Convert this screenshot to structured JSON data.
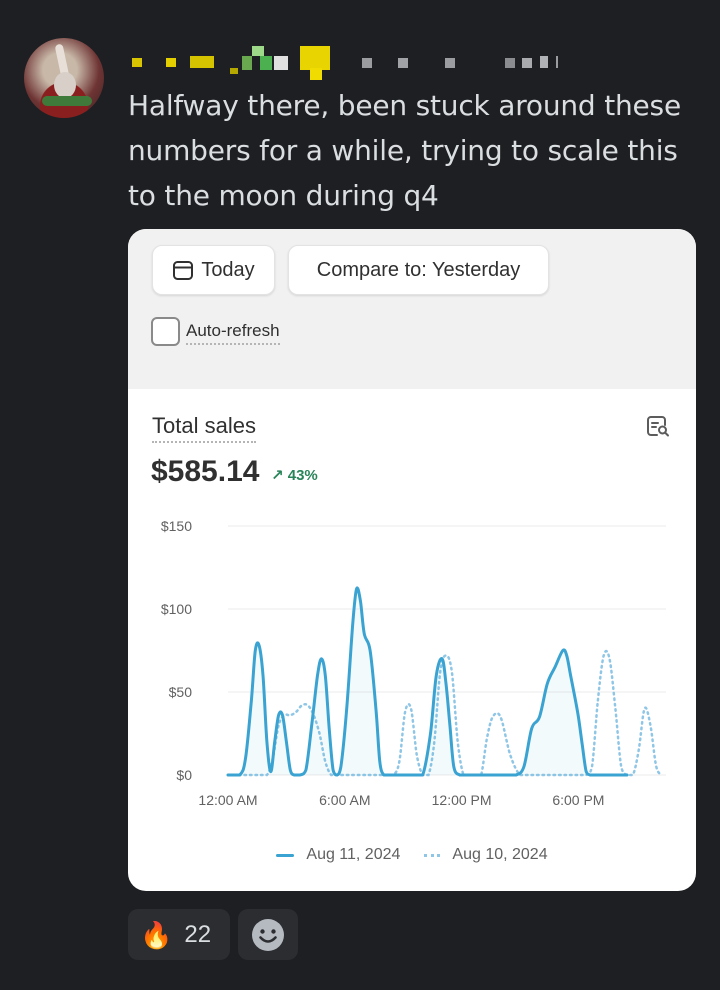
{
  "message": {
    "text": "Halfway there, been stuck around these numbers for a while, trying to scale this to the moon during q4"
  },
  "screenshot": {
    "date_button": "Today",
    "compare_button": "Compare to: Yesterday",
    "auto_refresh_label": "Auto-refresh",
    "auto_refresh_checked": false,
    "total_sales_label": "Total sales",
    "total_sales_value": "$585.14",
    "total_sales_change": "43%",
    "change_direction": "up",
    "colors": {
      "current": "#3aa3d2",
      "previous": "#8fc6e6",
      "positive": "#29845a"
    }
  },
  "chart_data": {
    "type": "line",
    "y_ticks": [
      "$150",
      "$100",
      "$50",
      "$0"
    ],
    "ylim": [
      0,
      150
    ],
    "x_ticks": [
      "12:00 AM",
      "6:00 AM",
      "12:00 PM",
      "6:00 PM"
    ],
    "series": [
      {
        "name": "Aug 11, 2024",
        "style": "solid",
        "x": [
          0,
          0.6,
          0.9,
          1.2,
          1.4,
          1.6,
          1.8,
          2.0,
          2.2,
          2.4,
          2.6,
          2.8,
          3.0,
          3.2,
          3.4,
          3.7,
          4.0,
          4.3,
          4.6,
          4.8,
          5.0,
          5.2,
          5.4,
          5.6,
          5.8,
          6.1,
          6.4,
          6.6,
          6.8,
          7.0,
          7.3,
          7.6,
          7.8,
          8.0,
          8.2,
          8.4,
          8.6,
          8.9,
          9.2,
          9.6,
          10.0,
          10.4,
          10.7,
          11.0,
          11.2,
          11.4,
          11.6,
          11.9,
          12.2,
          12.5,
          12.8,
          13.1,
          13.4,
          13.7,
          14.0,
          14.4,
          14.8,
          15.2,
          15.6,
          16.0,
          16.4,
          16.8,
          17.2,
          17.4,
          17.6,
          17.8,
          18.0,
          18.2,
          18.4,
          18.6,
          18.8,
          19.0,
          19.2,
          19.5,
          20.0,
          20.5
        ],
        "y": [
          0,
          0,
          10,
          45,
          75,
          78,
          60,
          20,
          2,
          20,
          36,
          36,
          20,
          3,
          0,
          0,
          3,
          30,
          60,
          70,
          60,
          28,
          3,
          0,
          5,
          40,
          90,
          112,
          105,
          85,
          75,
          40,
          8,
          0,
          0,
          0,
          0,
          0,
          0,
          0,
          0,
          25,
          60,
          70,
          55,
          30,
          5,
          0,
          0,
          0,
          0,
          0,
          0,
          0,
          0,
          0,
          0,
          5,
          28,
          35,
          55,
          65,
          75,
          72,
          60,
          48,
          35,
          18,
          2,
          0,
          0,
          0,
          0,
          0,
          0,
          0
        ]
      },
      {
        "name": "Aug 10, 2024",
        "style": "dotted",
        "x": [
          0,
          0.5,
          1.0,
          1.5,
          2.0,
          2.3,
          2.6,
          2.9,
          3.2,
          3.5,
          3.8,
          4.1,
          4.4,
          4.7,
          5.0,
          5.3,
          5.6,
          5.9,
          6.2,
          6.5,
          7.0,
          7.3,
          7.6,
          7.9,
          8.2,
          8.5,
          8.8,
          9.1,
          9.4,
          9.7,
          10.0,
          10.3,
          10.6,
          10.9,
          11.2,
          11.5,
          11.8,
          12.1,
          12.4,
          12.7,
          13.0,
          13.3,
          13.6,
          14.0,
          14.5,
          15.0,
          15.5,
          16.0,
          16.5,
          17.0,
          17.4,
          17.8,
          18.1,
          18.4,
          18.7,
          19.0,
          19.3,
          19.6,
          19.9,
          20.2,
          20.5,
          20.8,
          21.1,
          21.4,
          21.7,
          22.0,
          22.3
        ],
        "y": [
          0,
          0,
          0,
          0,
          0,
          10,
          30,
          36,
          36,
          38,
          42,
          42,
          36,
          25,
          8,
          0,
          0,
          0,
          0,
          0,
          0,
          0,
          0,
          0,
          0,
          0,
          8,
          38,
          40,
          12,
          0,
          0,
          20,
          62,
          72,
          62,
          20,
          0,
          0,
          0,
          0,
          22,
          35,
          35,
          12,
          0,
          0,
          0,
          0,
          0,
          0,
          0,
          0,
          0,
          5,
          45,
          72,
          70,
          40,
          5,
          0,
          0,
          15,
          40,
          30,
          5,
          0
        ]
      }
    ],
    "legend": "bottom-center",
    "grid": true
  },
  "reactions": [
    {
      "icon": "fire-icon",
      "emoji": "🔥",
      "count": "22"
    }
  ]
}
